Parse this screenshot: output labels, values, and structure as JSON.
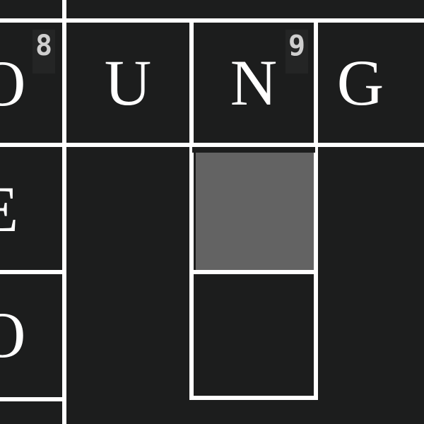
{
  "puzzle": {
    "row_top": {
      "cells": [
        {
          "letter": "O",
          "clue_number": "8"
        },
        {
          "letter": "U",
          "clue_number": ""
        },
        {
          "letter": "N",
          "clue_number": "9"
        },
        {
          "letter": "G",
          "clue_number": ""
        }
      ]
    },
    "left_column": {
      "cells": [
        {
          "letter": "E"
        },
        {
          "letter": "O"
        }
      ]
    },
    "active_cell": {
      "letter": "",
      "fill_color": "#636363"
    },
    "below_active": {
      "letter": ""
    },
    "colors": {
      "background": "#1c1d1d",
      "grid_line": "#ffffff",
      "clue_number": "#cfcfcf",
      "active": "#636363"
    }
  }
}
